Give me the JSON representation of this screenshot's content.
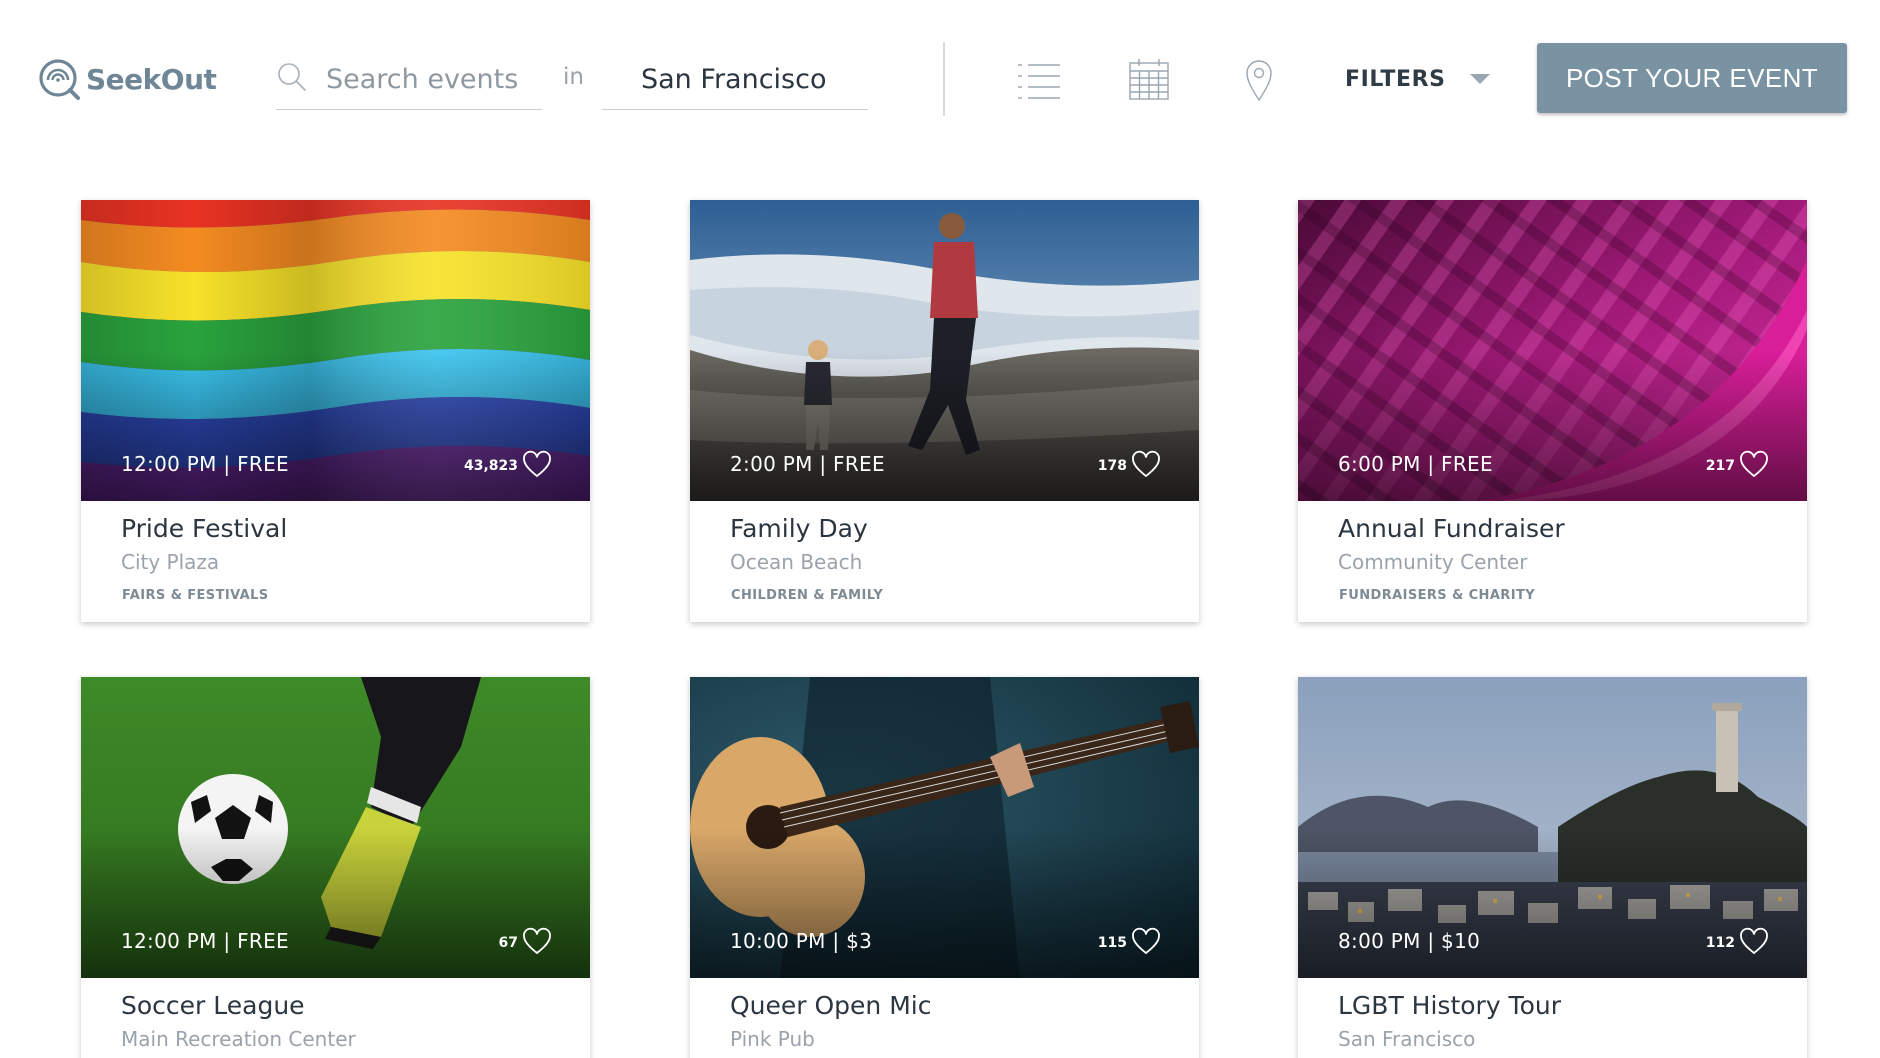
{
  "brand": {
    "name": "SeekOut",
    "accent": "#6f8696"
  },
  "search": {
    "placeholder": "Search events",
    "value": "",
    "in_label": "in",
    "location": "San Francisco"
  },
  "toolbar": {
    "views": [
      "list-view-icon",
      "calendar-view-icon",
      "map-view-icon"
    ],
    "filters_label": "FILTERS",
    "post_button_label": "POST YOUR EVENT",
    "post_button_color": "#7a93a2"
  },
  "events": [
    {
      "time": "12:00 PM  |  FREE",
      "likes": "43,823",
      "title": "Pride Festival",
      "venue": "City Plaza",
      "category": "FAIRS & FESTIVALS",
      "image": "rainbow-flag-photo"
    },
    {
      "time": "2:00 PM  |  FREE",
      "likes": "178",
      "title": "Family Day",
      "venue": "Ocean Beach",
      "category": "CHILDREN &  FAMILY",
      "image": "beach-family-photo"
    },
    {
      "time": "6:00 PM  |  FREE",
      "likes": "217",
      "title": "Annual Fundraiser",
      "venue": "Community Center",
      "category": "FUNDRAISERS & CHARITY",
      "image": "pink-abstract-photo"
    },
    {
      "time": "12:00 PM  |  FREE",
      "likes": "67",
      "title": "Soccer League",
      "venue": "Main Recreation Center",
      "category": "",
      "image": "soccer-ball-photo"
    },
    {
      "time": "10:00 PM  |  $3",
      "likes": "115",
      "title": "Queer Open Mic",
      "venue": "Pink Pub",
      "category": "",
      "image": "guitar-photo"
    },
    {
      "time": "8:00 PM  |  $10",
      "likes": "112",
      "title": "LGBT History Tour",
      "venue": "San Francisco",
      "category": "",
      "image": "coit-tower-photo"
    }
  ]
}
